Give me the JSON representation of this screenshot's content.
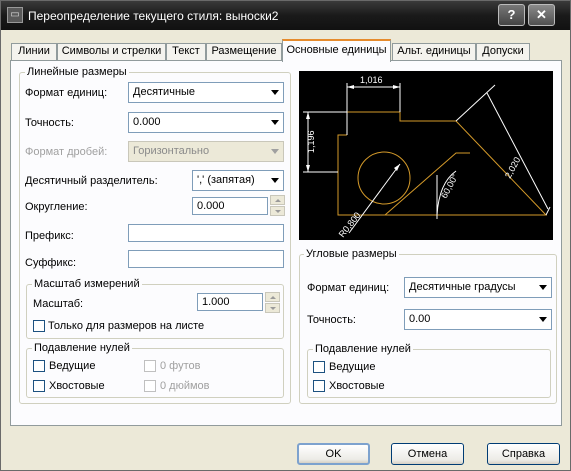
{
  "window": {
    "title": "Переопределение текущего стиля: выноски2",
    "help_label": "?",
    "close_label": "✕",
    "icon": "dim-style-icon"
  },
  "tabs": [
    {
      "label": "Линии"
    },
    {
      "label": "Символы и стрелки"
    },
    {
      "label": "Текст"
    },
    {
      "label": "Размещение"
    },
    {
      "label": "Основные единицы",
      "active": true
    },
    {
      "label": "Альт. единицы"
    },
    {
      "label": "Допуски"
    }
  ],
  "linear": {
    "title": "Линейные размеры",
    "unit_format_label": "Формат единиц:",
    "unit_format_value": "Десятичные",
    "precision_label": "Точность:",
    "precision_value": "0.000",
    "fraction_format_label": "Формат дробей:",
    "fraction_format_value": "Горизонтально",
    "decimal_sep_label": "Десятичный разделитель:",
    "decimal_sep_value": "',' (запятая)",
    "roundoff_label": "Округление:",
    "roundoff_value": "0.000",
    "prefix_label": "Префикс:",
    "prefix_value": "",
    "suffix_label": "Суффикс:",
    "suffix_value": ""
  },
  "scale": {
    "title": "Масштаб измерений",
    "scale_label": "Масштаб:",
    "scale_value": "1.000",
    "layout_only_label": "Только для размеров на листе",
    "layout_only_checked": false
  },
  "zero_linear": {
    "title": "Подавление нулей",
    "leading_label": "Ведущие",
    "trailing_label": "Хвостовые",
    "feet_label": "0 футов",
    "inches_label": "0 дюймов"
  },
  "preview": {
    "dim_top": "1,016",
    "dim_left": "1,196",
    "dim_right": "2,020",
    "dim_angle": "60,00°",
    "dim_radius": "R0,800"
  },
  "angular": {
    "title": "Угловые размеры",
    "unit_format_label": "Формат единиц:",
    "unit_format_value": "Десятичные градусы",
    "precision_label": "Точность:",
    "precision_value": "0.00"
  },
  "zero_angular": {
    "title": "Подавление нулей",
    "leading_label": "Ведущие",
    "trailing_label": "Хвостовые"
  },
  "buttons": {
    "ok": "OK",
    "cancel": "Отмена",
    "help": "Справка"
  }
}
